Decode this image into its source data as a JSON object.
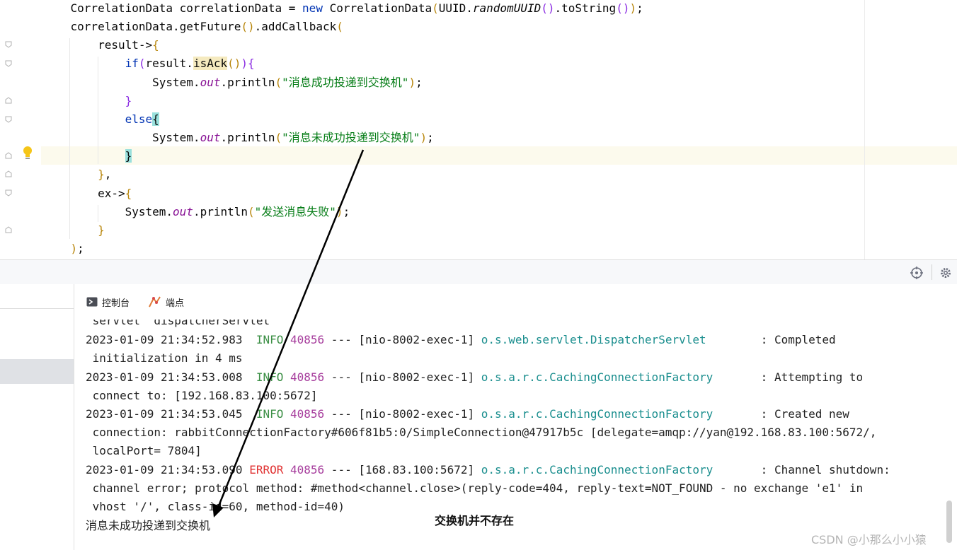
{
  "editor": {
    "lines": [
      {
        "indent": "    ",
        "segments": [
          {
            "t": "CorrelationData correlationData = ",
            "c": ""
          },
          {
            "t": "new",
            "c": "kw"
          },
          {
            "t": " CorrelationData",
            "c": ""
          },
          {
            "t": "(",
            "c": "par"
          },
          {
            "t": "UUID.",
            "c": ""
          },
          {
            "t": "randomUUID",
            "c": "ital"
          },
          {
            "t": "()",
            "c": "brk"
          },
          {
            "t": ".toString",
            "c": ""
          },
          {
            "t": "()",
            "c": "brk"
          },
          {
            "t": ")",
            "c": "par"
          },
          {
            "t": ";",
            "c": ""
          }
        ]
      },
      {
        "indent": "    ",
        "segments": [
          {
            "t": "correlationData.getFuture",
            "c": ""
          },
          {
            "t": "()",
            "c": "par"
          },
          {
            "t": ".addCallback",
            "c": ""
          },
          {
            "t": "(",
            "c": "par"
          }
        ]
      },
      {
        "indent": "        ",
        "segments": [
          {
            "t": "result->",
            "c": ""
          },
          {
            "t": "{",
            "c": "par"
          }
        ]
      },
      {
        "indent": "            ",
        "segments": [
          {
            "t": "if",
            "c": "kw"
          },
          {
            "t": "(",
            "c": "brk"
          },
          {
            "t": "result.",
            "c": ""
          },
          {
            "t": "isAck",
            "c": "isack"
          },
          {
            "t": "()",
            "c": "par"
          },
          {
            "t": ")",
            "c": "brk"
          },
          {
            "t": "{",
            "c": "brk"
          }
        ]
      },
      {
        "indent": "                ",
        "segments": [
          {
            "t": "System.",
            "c": ""
          },
          {
            "t": "out",
            "c": "fld"
          },
          {
            "t": ".println",
            "c": ""
          },
          {
            "t": "(",
            "c": "par"
          },
          {
            "t": "\"消息成功投递到交换机\"",
            "c": "str"
          },
          {
            "t": ")",
            "c": "par"
          },
          {
            "t": ";",
            "c": ""
          }
        ]
      },
      {
        "indent": "            ",
        "segments": [
          {
            "t": "}",
            "c": "brk"
          }
        ]
      },
      {
        "indent": "            ",
        "segments": [
          {
            "t": "else",
            "c": "kw"
          },
          {
            "t": "{",
            "c": "brace-hl"
          }
        ]
      },
      {
        "indent": "                ",
        "segments": [
          {
            "t": "System.",
            "c": ""
          },
          {
            "t": "out",
            "c": "fld"
          },
          {
            "t": ".println",
            "c": ""
          },
          {
            "t": "(",
            "c": "par"
          },
          {
            "t": "\"消息未成功投递到交换机\"",
            "c": "str"
          },
          {
            "t": ")",
            "c": "par"
          },
          {
            "t": ";",
            "c": ""
          }
        ]
      },
      {
        "indent": "            ",
        "segments": [
          {
            "t": "}",
            "c": "brace-hl"
          }
        ]
      },
      {
        "indent": "        ",
        "segments": [
          {
            "t": "}",
            "c": "par"
          },
          {
            "t": ",",
            "c": ""
          }
        ]
      },
      {
        "indent": "        ",
        "segments": [
          {
            "t": "ex->",
            "c": ""
          },
          {
            "t": "{",
            "c": "par"
          }
        ]
      },
      {
        "indent": "            ",
        "segments": [
          {
            "t": "System.",
            "c": ""
          },
          {
            "t": "out",
            "c": "fld"
          },
          {
            "t": ".println",
            "c": ""
          },
          {
            "t": "(",
            "c": "par"
          },
          {
            "t": "\"发送消息失败\"",
            "c": "str"
          },
          {
            "t": ")",
            "c": "par"
          },
          {
            "t": ";",
            "c": ""
          }
        ]
      },
      {
        "indent": "        ",
        "segments": [
          {
            "t": "}",
            "c": "par"
          }
        ]
      },
      {
        "indent": "    ",
        "segments": [
          {
            "t": ")",
            "c": "par"
          },
          {
            "t": ";",
            "c": ""
          }
        ]
      }
    ]
  },
  "tabs": {
    "console": "控制台",
    "breakpoints": "端点"
  },
  "console": {
    "lines": [
      [
        {
          "t": " servlet 'dispatcherServlet'",
          "c": ""
        }
      ],
      [
        {
          "t": "2023-01-09 21:34:52.983  ",
          "c": ""
        },
        {
          "t": "INFO",
          "c": "info"
        },
        {
          "t": " ",
          "c": ""
        },
        {
          "t": "40856",
          "c": "pid"
        },
        {
          "t": " --- [nio-8002-exec-1] ",
          "c": ""
        },
        {
          "t": "o.s.web.servlet.DispatcherServlet",
          "c": "logger"
        },
        {
          "t": "        : Completed",
          "c": ""
        }
      ],
      [
        {
          "t": " initialization in 4 ms",
          "c": ""
        }
      ],
      [
        {
          "t": "2023-01-09 21:34:53.008  ",
          "c": ""
        },
        {
          "t": "INFO",
          "c": "info"
        },
        {
          "t": " ",
          "c": ""
        },
        {
          "t": "40856",
          "c": "pid"
        },
        {
          "t": " --- [nio-8002-exec-1] ",
          "c": ""
        },
        {
          "t": "o.s.a.r.c.CachingConnectionFactory",
          "c": "logger"
        },
        {
          "t": "       : Attempting to",
          "c": ""
        }
      ],
      [
        {
          "t": " connect to: [192.168.83.100:5672]",
          "c": ""
        }
      ],
      [
        {
          "t": "2023-01-09 21:34:53.045  ",
          "c": ""
        },
        {
          "t": "INFO",
          "c": "info"
        },
        {
          "t": " ",
          "c": ""
        },
        {
          "t": "40856",
          "c": "pid"
        },
        {
          "t": " --- [nio-8002-exec-1] ",
          "c": ""
        },
        {
          "t": "o.s.a.r.c.CachingConnectionFactory",
          "c": "logger"
        },
        {
          "t": "       : Created new",
          "c": ""
        }
      ],
      [
        {
          "t": " connection: rabbitConnectionFactory#606f81b5:0/SimpleConnection@47917b5c [delegate=amqp://yan@192.168.83.100:5672/,",
          "c": ""
        }
      ],
      [
        {
          "t": " localPort= 7804]",
          "c": ""
        }
      ],
      [
        {
          "t": "2023-01-09 21:34:53.090 ",
          "c": ""
        },
        {
          "t": "ERROR",
          "c": "err"
        },
        {
          "t": " ",
          "c": ""
        },
        {
          "t": "40856",
          "c": "pid"
        },
        {
          "t": " --- [168.83.100:5672] ",
          "c": ""
        },
        {
          "t": "o.s.a.r.c.CachingConnectionFactory",
          "c": "logger"
        },
        {
          "t": "       : Channel shutdown:",
          "c": ""
        }
      ],
      [
        {
          "t": " channel error; protocol method: #method<channel.close>(reply-code=404, reply-text=NOT_FOUND - no exchange 'e1' in",
          "c": ""
        }
      ],
      [
        {
          "t": " vhost '/', class-id=60, method-id=40)",
          "c": ""
        }
      ],
      [
        {
          "t": "消息未成功投递到交换机",
          "c": ""
        }
      ]
    ]
  },
  "annotation": "交换机并不存在",
  "watermark": "CSDN @小那么小小猿",
  "icons": {
    "run": "console-icon",
    "breakpoints": "breakpoints-icon",
    "target": "crosshair-icon",
    "settings": "gear-icon",
    "bulb": "lightbulb-icon"
  }
}
